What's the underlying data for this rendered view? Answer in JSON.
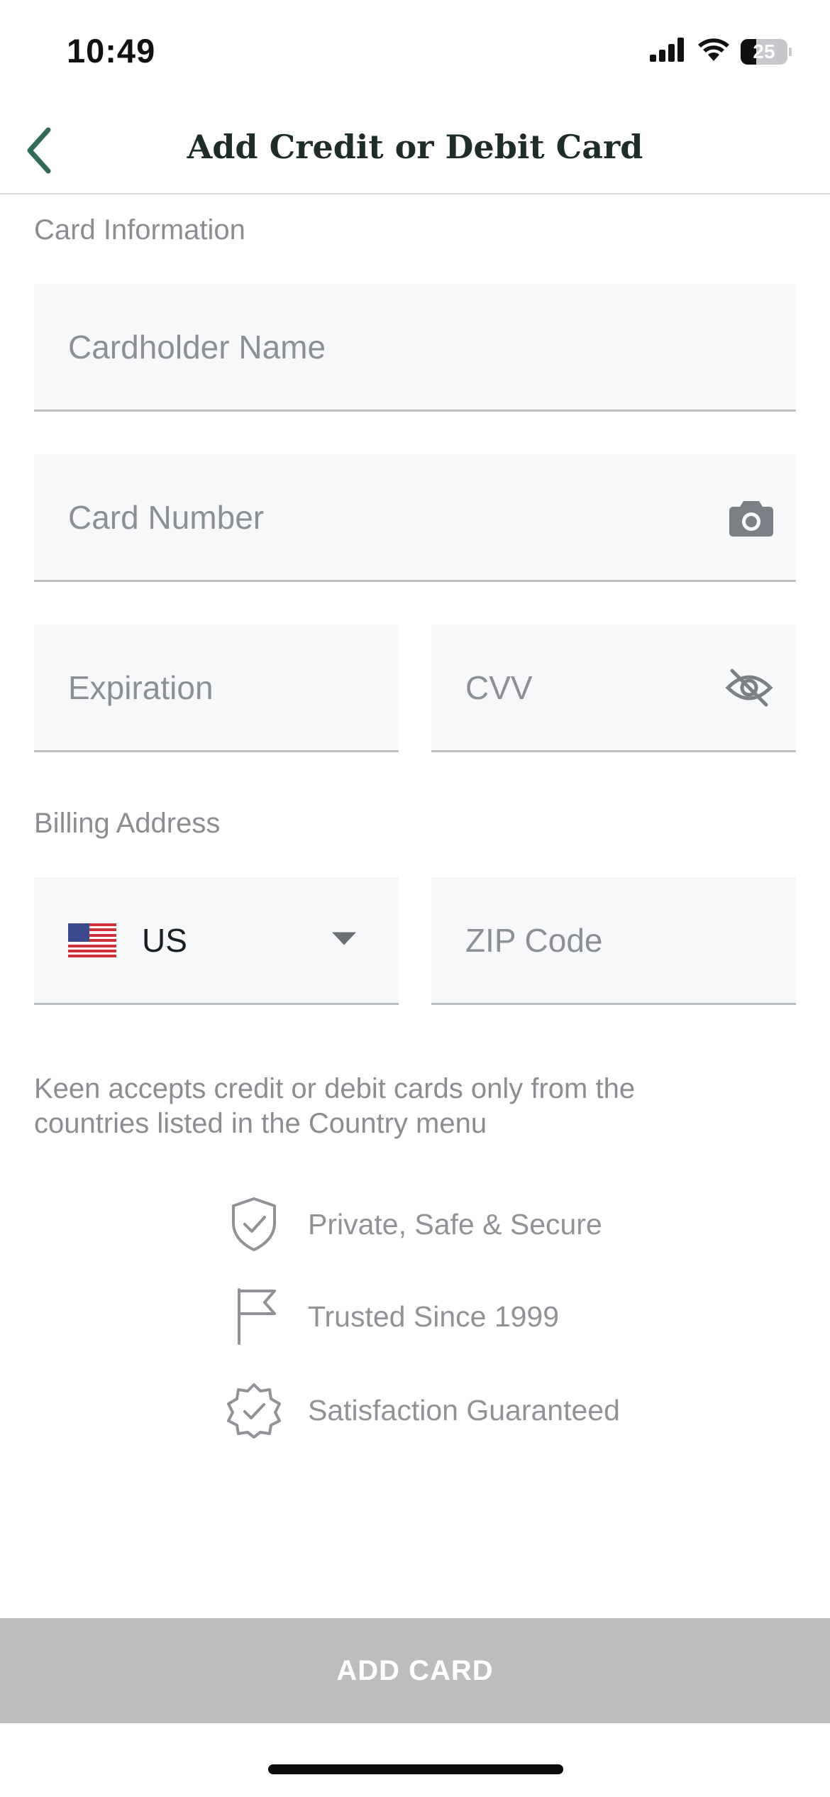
{
  "status_bar": {
    "time": "10:49",
    "battery": "25"
  },
  "header": {
    "title": "Add Credit or Debit Card",
    "back_icon": "chevron-left-icon",
    "accent_color": "#2f6b55"
  },
  "card_information": {
    "section_label": "Card Information",
    "cardholder_placeholder": "Cardholder Name",
    "card_number_placeholder": "Card Number",
    "expiration_placeholder": "Expiration",
    "cvv_placeholder": "CVV"
  },
  "billing_address": {
    "section_label": "Billing Address",
    "country_value": "US",
    "zip_placeholder": "ZIP Code"
  },
  "note": "Keen accepts credit or debit cards only from the countries listed in the Country menu",
  "trust_items": [
    {
      "icon": "shield-check-icon",
      "label": "Private, Safe & Secure"
    },
    {
      "icon": "flag-icon",
      "label": "Trusted Since 1999"
    },
    {
      "icon": "badge-check-icon",
      "label": "Satisfaction Guaranteed"
    }
  ],
  "add_card_button": {
    "label": "ADD CARD",
    "background": "#bdbdbd"
  }
}
